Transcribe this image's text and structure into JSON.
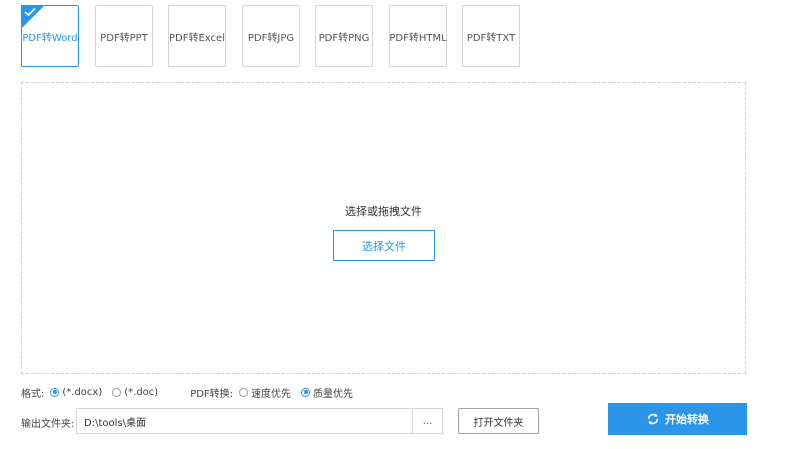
{
  "tabs": [
    {
      "label": "PDF转Word",
      "active": true
    },
    {
      "label": "PDF转PPT"
    },
    {
      "label": "PDF转Excel"
    },
    {
      "label": "PDF转JPG"
    },
    {
      "label": "PDF转PNG"
    },
    {
      "label": "PDF转HTML"
    },
    {
      "label": "PDF转TXT"
    }
  ],
  "dropzone": {
    "hint": "选择或拖拽文件",
    "select_button": "选择文件"
  },
  "options": {
    "format_label": "格式:",
    "format_docx": "(*.docx)",
    "format_doc": "(*.doc)",
    "selected_format": "(*.docx)",
    "mode_label": "PDF转换:",
    "mode_speed": "速度优先",
    "mode_quality": "质量优先",
    "selected_mode": "质量优先"
  },
  "output": {
    "label": "输出文件夹:",
    "path": "D:\\tools\\桌面",
    "browse": "...",
    "open_folder": "打开文件夹"
  },
  "start_button": "开始转换",
  "colors": {
    "accent": "#2b95e9"
  },
  "icons": {
    "active_tab": "check-icon",
    "start": "refresh-icon"
  }
}
